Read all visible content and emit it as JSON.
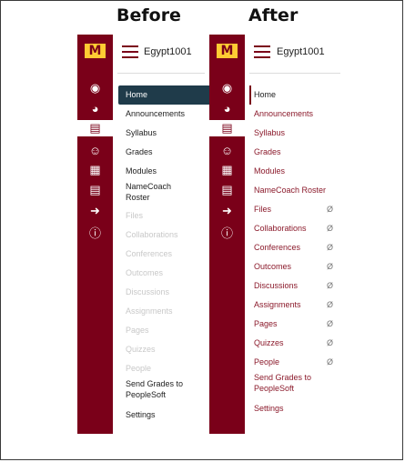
{
  "labels": {
    "before": "Before",
    "after": "After"
  },
  "course_name": "Egypt1001",
  "logo_text": "M",
  "colors": {
    "rail": "#7a0019",
    "active_bg": "#1f3b4a",
    "link": "#8b1a2b",
    "logo": "#ffcc33"
  },
  "rail_icons": [
    "account-icon",
    "dashboard-icon",
    "courses-icon",
    "groups-icon",
    "calendar-icon",
    "inbox-icon",
    "commons-icon",
    "help-icon"
  ],
  "before": {
    "items": [
      "Home",
      "Announcements",
      "Syllabus",
      "Grades",
      "Modules",
      "NameCoach",
      "Roster",
      "Files",
      "Collaborations",
      "Conferences",
      "Outcomes",
      "Discussions",
      "Assignments",
      "Pages",
      "Quizzes",
      "People",
      "Send Grades to",
      "PeopleSoft",
      "Settings"
    ]
  },
  "after": {
    "items": [
      "Home",
      "Announcements",
      "Syllabus",
      "Grades",
      "Modules",
      "NameCoach Roster",
      "Files",
      "Collaborations",
      "Conferences",
      "Outcomes",
      "Discussions",
      "Assignments",
      "Pages",
      "Quizzes",
      "People",
      "Send Grades to",
      "PeopleSoft",
      "Settings"
    ]
  }
}
